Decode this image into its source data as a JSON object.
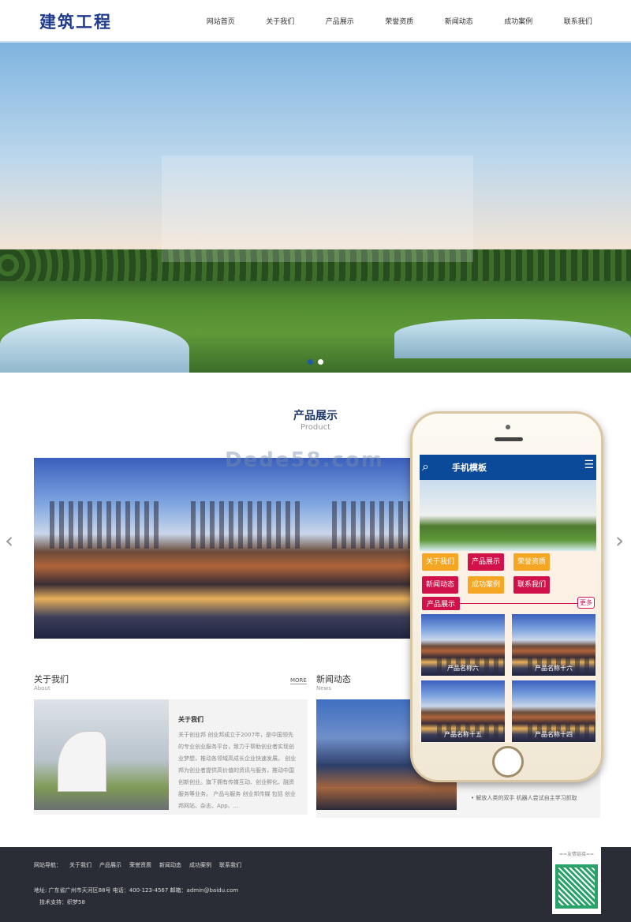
{
  "header": {
    "logo": "建筑工程",
    "nav": [
      "网站首页",
      "关于我们",
      "产品展示",
      "荣誉资质",
      "新闻动态",
      "成功案例",
      "联系我们"
    ]
  },
  "products": {
    "title": "产品展示",
    "subtitle": "Product",
    "watermark": "Dede58.com",
    "prev": "‹",
    "next": "›"
  },
  "about": {
    "title": "关于我们",
    "subtitle": "About",
    "more": "MORE",
    "heading": "关于我们",
    "text": "关于创业邦 创业邦成立于2007年，是中国领先的专业创业服务平台，致力于帮助创业者实现创业梦想，推动各领域高成长企业快速发展。 创业邦为创业者提供高价值的资讯与服务，推动中国创新创业。旗下拥有传媒互动、创业孵化、融资服务等业务。 产品与服务 创业邦传媒 包括 创业邦网站、杂志、App、..."
  },
  "news": {
    "title": "新闻动态",
    "subtitle": "News",
    "items": [
      "解放人类的双手 机器人尝试自主学习抓取"
    ]
  },
  "phone": {
    "title": "手机模板",
    "buttons": [
      {
        "label": "关于我们",
        "color": "#f5a623"
      },
      {
        "label": "产品展示",
        "color": "#d0114a"
      },
      {
        "label": "荣誉资质",
        "color": "#f5a623"
      },
      {
        "label": "新闻动态",
        "color": "#d0114a"
      },
      {
        "label": "成功案例",
        "color": "#f5a623"
      },
      {
        "label": "联系我们",
        "color": "#d0114a"
      }
    ],
    "section": "产品展示",
    "more": "更多",
    "items": [
      "产品名称六",
      "产品名称十六",
      "产品名称十五",
      "产品名称十四"
    ]
  },
  "footer": {
    "nav_label": "网站导航：",
    "nav": [
      "关于我们",
      "产品展示",
      "荣誉资质",
      "新闻动态",
      "成功案例",
      "联系我们"
    ],
    "address": "地址: 广东省广州市天河区88号 电话：400-123-4567 邮箱：admin@baidu.com",
    "tech": "技术支持：织梦58",
    "links_label": "==友情链接=="
  }
}
